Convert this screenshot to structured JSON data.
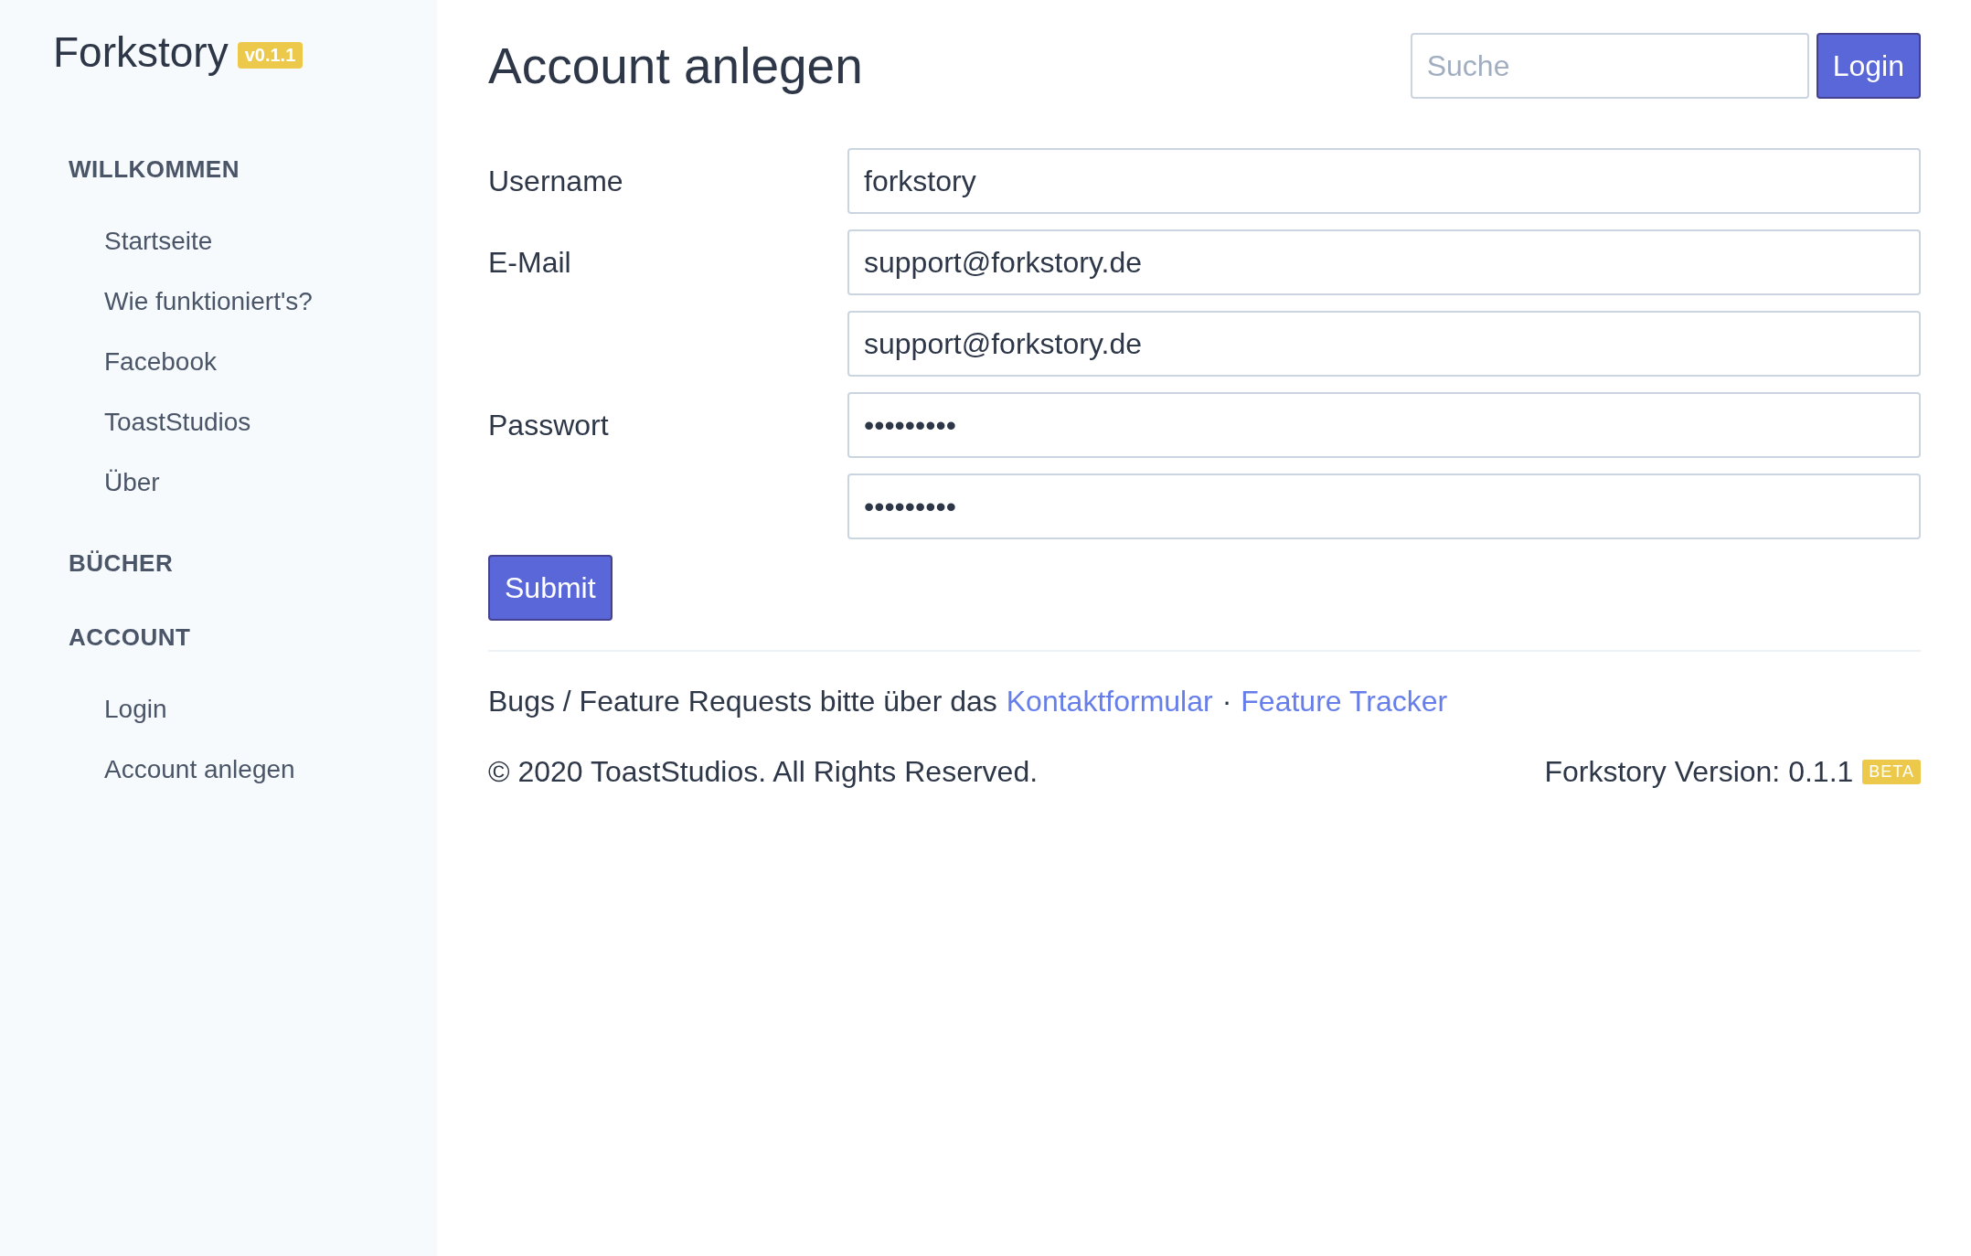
{
  "sidebar": {
    "brand": "Forkstory",
    "version_badge": "v0.1.1",
    "sections": [
      {
        "heading": "WILLKOMMEN",
        "items": [
          "Startseite",
          "Wie funktioniert's?",
          "Facebook",
          "ToastStudios",
          "Über"
        ]
      },
      {
        "heading": "BÜCHER"
      },
      {
        "heading": "ACCOUNT",
        "items": [
          "Login",
          "Account anlegen"
        ]
      }
    ]
  },
  "header": {
    "title": "Account anlegen",
    "search": {
      "placeholder": "Suche"
    },
    "login_button": "Login"
  },
  "form": {
    "rows": [
      {
        "label": "Username",
        "value": "forkstory"
      },
      {
        "label": "E-Mail",
        "value": "support@forkstory.de"
      },
      {
        "value": "support@forkstory.de"
      },
      {
        "label": "Passwort",
        "value": "•••••••••"
      },
      {
        "value": "•••••••••"
      }
    ],
    "submit": "Submit"
  },
  "footer": {
    "note": "Bugs / Feature Requests bitte über das",
    "links": [
      "Kontaktformular",
      "Feature Tracker"
    ],
    "separator": "·",
    "copyright": "© 2020 ToastStudios. All Rights Reserved.",
    "version": "Forkstory Version: 0.1.1",
    "badge": "BETA"
  }
}
